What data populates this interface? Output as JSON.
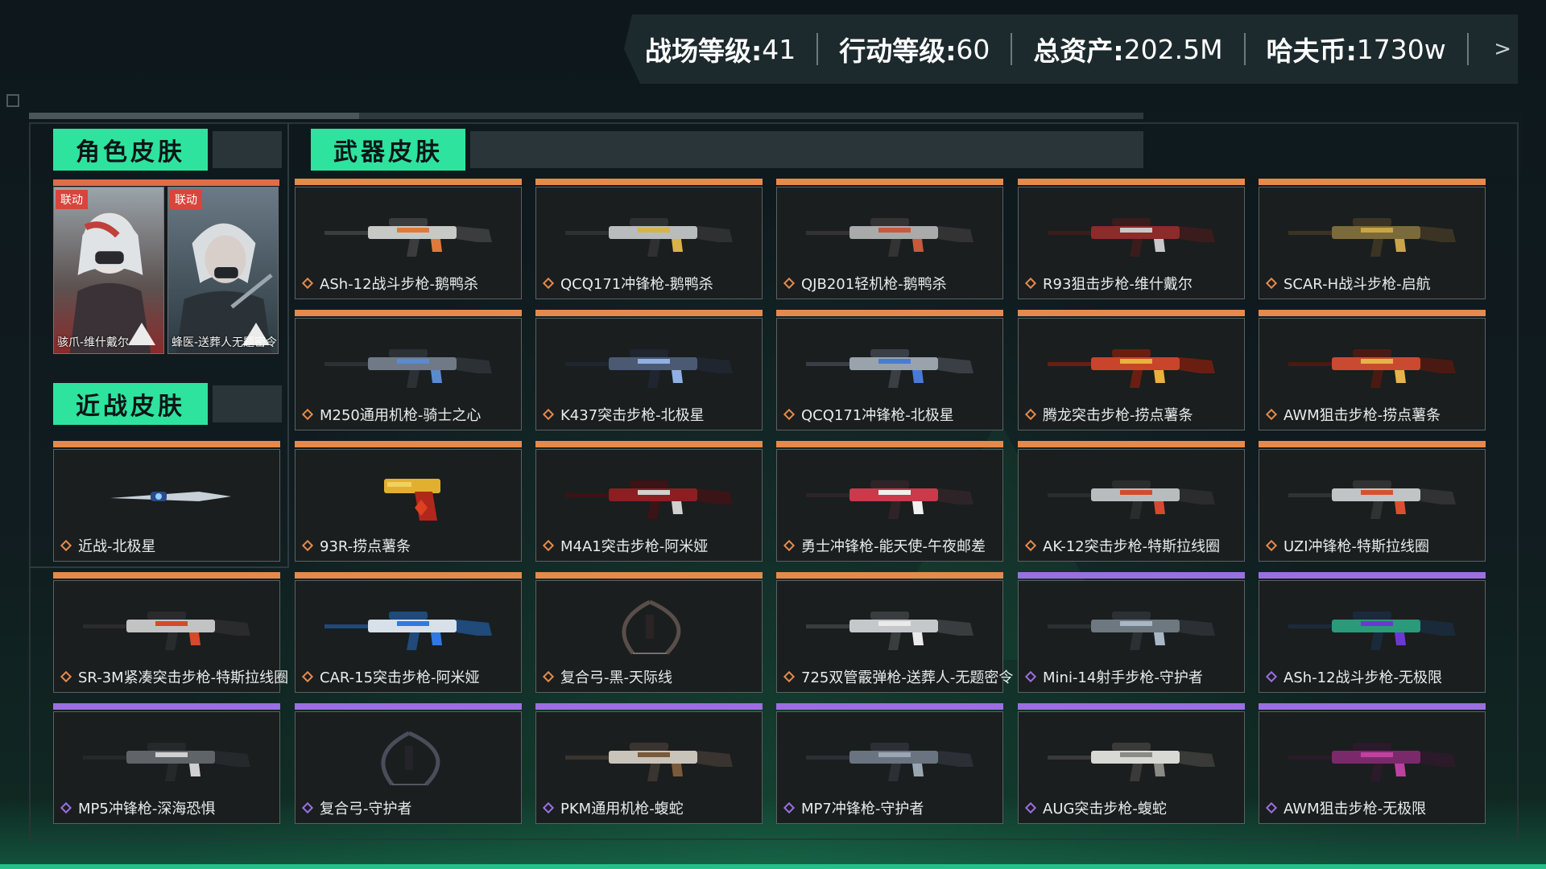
{
  "header": {
    "stats": [
      {
        "label": "战场等级:",
        "value": "41"
      },
      {
        "label": "行动等级:",
        "value": "60"
      },
      {
        "label": "总资产:",
        "value": "202.5M"
      },
      {
        "label": "哈夫币:",
        "value": "1730w"
      }
    ],
    "arrow": ">"
  },
  "sections": {
    "character": "角色皮肤",
    "melee": "近战皮肤",
    "weapon": "武器皮肤"
  },
  "character_skins": [
    {
      "tag": "联动",
      "name": "骇爪-维什戴尔"
    },
    {
      "tag": "联动",
      "name": "蜂医-送葬人无题密令"
    }
  ],
  "melee_skins": [
    {
      "name": "近战-北极星",
      "rarity": "orange"
    }
  ],
  "weapon_skins": [
    {
      "name": "ASh-12战斗步枪-鹅鸭杀",
      "rarity": "orange"
    },
    {
      "name": "QCQ171冲锋枪-鹅鸭杀",
      "rarity": "orange"
    },
    {
      "name": "QJB201轻机枪-鹅鸭杀",
      "rarity": "orange"
    },
    {
      "name": "R93狙击步枪-维什戴尔",
      "rarity": "orange"
    },
    {
      "name": "SCAR-H战斗步枪-启航",
      "rarity": "orange"
    },
    {
      "name": "M250通用机枪-骑士之心",
      "rarity": "orange"
    },
    {
      "name": "K437突击步枪-北极星",
      "rarity": "orange"
    },
    {
      "name": "QCQ171冲锋枪-北极星",
      "rarity": "orange"
    },
    {
      "name": "腾龙突击步枪-捞点薯条",
      "rarity": "orange"
    },
    {
      "name": "AWM狙击步枪-捞点薯条",
      "rarity": "orange"
    },
    {
      "name": "93R-捞点薯条",
      "rarity": "orange"
    },
    {
      "name": "M4A1突击步枪-阿米娅",
      "rarity": "orange"
    },
    {
      "name": "勇士冲锋枪-能天使-午夜邮差",
      "rarity": "orange"
    },
    {
      "name": "AK-12突击步枪-特斯拉线圈",
      "rarity": "orange"
    },
    {
      "name": "UZI冲锋枪-特斯拉线圈",
      "rarity": "orange"
    },
    {
      "name": "SR-3M紧凑突击步枪-特斯拉线圈",
      "rarity": "orange"
    },
    {
      "name": "CAR-15突击步枪-阿米娅",
      "rarity": "orange"
    },
    {
      "name": "复合弓-黑-天际线",
      "rarity": "orange"
    },
    {
      "name": "725双管霰弹枪-送葬人-无题密令",
      "rarity": "orange"
    },
    {
      "name": "Mini-14射手步枪-守护者",
      "rarity": "purple"
    },
    {
      "name": "ASh-12战斗步枪-无极限",
      "rarity": "purple"
    },
    {
      "name": "MP5冲锋枪-深海恐惧",
      "rarity": "purple"
    },
    {
      "name": "复合弓-守护者",
      "rarity": "purple"
    },
    {
      "name": "PKM通用机枪-蝮蛇",
      "rarity": "purple"
    },
    {
      "name": "MP7冲锋枪-守护者",
      "rarity": "purple"
    },
    {
      "name": "AUG突击步枪-蝮蛇",
      "rarity": "purple"
    },
    {
      "name": "AWM狙击步枪-无极限",
      "rarity": "purple"
    }
  ],
  "colors": {
    "accent_green": "#2ee39e",
    "rarity_orange": "#e58a4c",
    "rarity_purple": "#9b6fe0",
    "link_tag_red": "#d8453c"
  }
}
